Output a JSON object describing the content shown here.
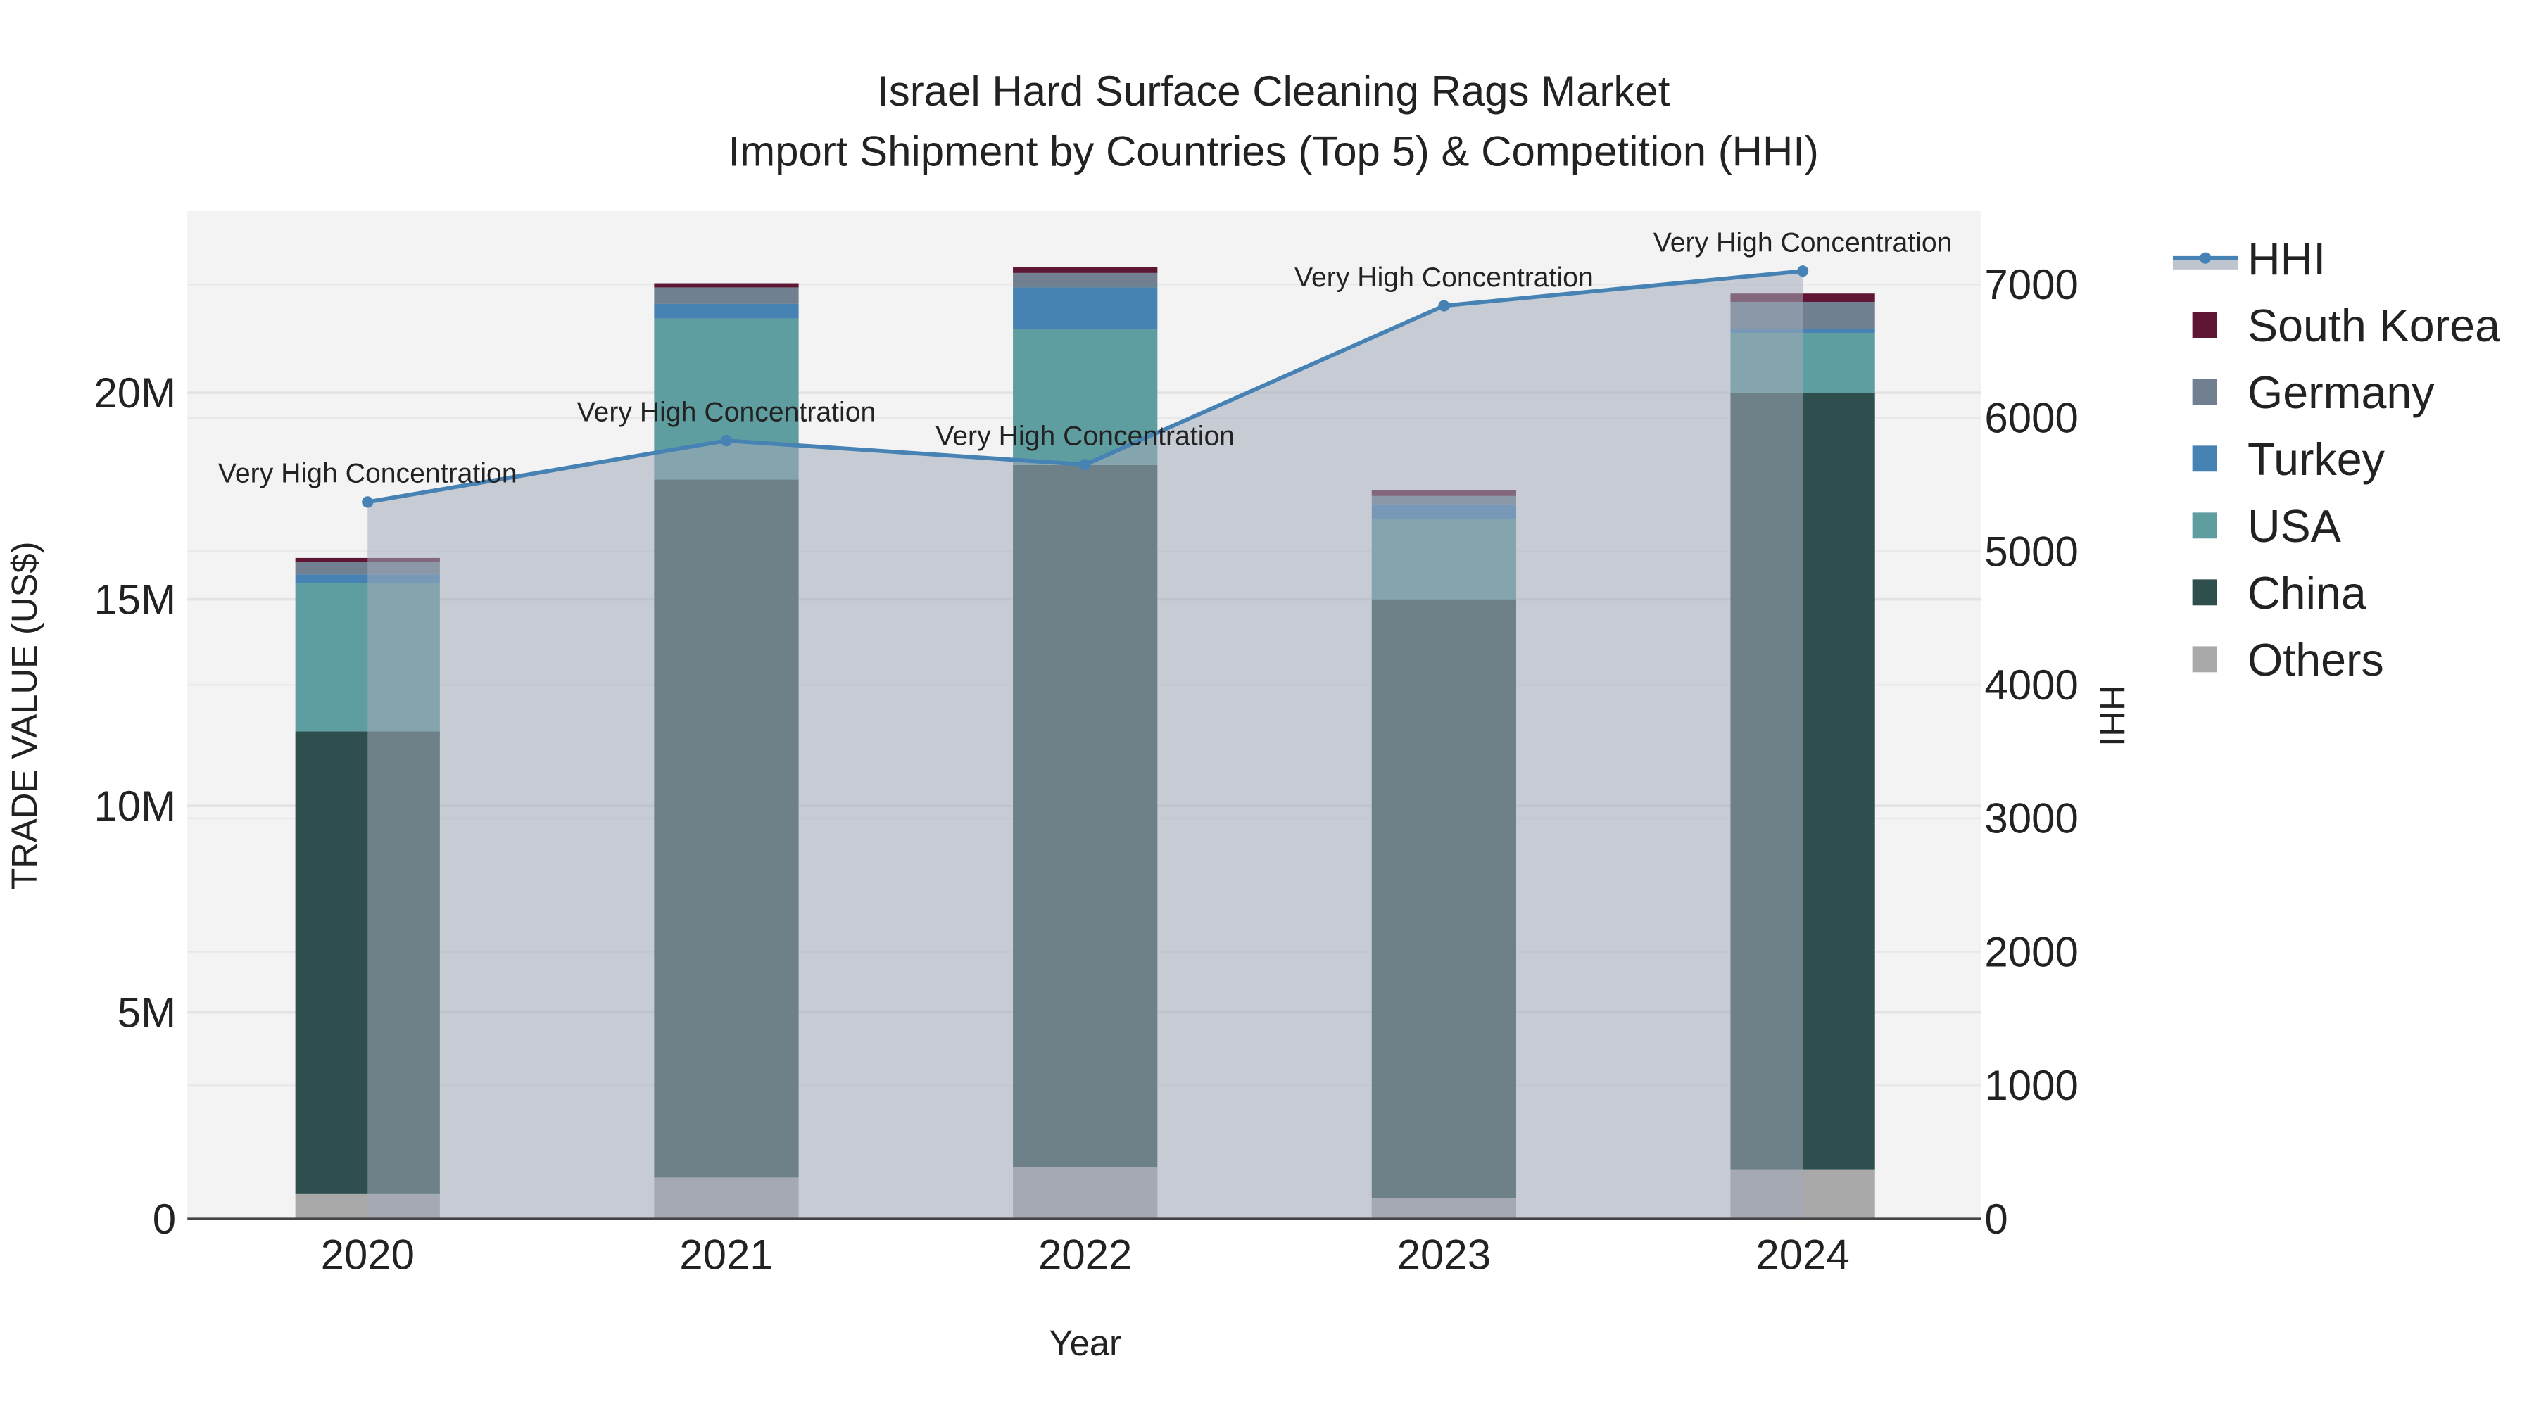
{
  "chart_data": {
    "type": "bar",
    "title": "Israel Hard Surface Cleaning Rags Market",
    "subtitle": "Import Shipment by Countries (Top 5) & Competition (HHI)",
    "xlabel": "Year",
    "ylabel": "TRADE VALUE (US$)",
    "y2label": "HHI",
    "categories": [
      "2020",
      "2021",
      "2022",
      "2023",
      "2024"
    ],
    "ylim": [
      0,
      24400000
    ],
    "y2lim": [
      0,
      7550
    ],
    "yticks": [
      {
        "v": 0,
        "label": "0"
      },
      {
        "v": 5000000,
        "label": "5M"
      },
      {
        "v": 10000000,
        "label": "10M"
      },
      {
        "v": 15000000,
        "label": "15M"
      },
      {
        "v": 20000000,
        "label": "20M"
      }
    ],
    "y2ticks": [
      0,
      1000,
      2000,
      3000,
      4000,
      5000,
      6000,
      7000
    ],
    "grid": true,
    "legend_placement": "right",
    "series": [
      {
        "name": "Others",
        "color": "#a9a9a9",
        "values": [
          600000,
          1000000,
          1250000,
          500000,
          1200000
        ]
      },
      {
        "name": "China",
        "color": "#2f4f4f",
        "values": [
          11200000,
          16900000,
          17000000,
          14500000,
          18800000
        ]
      },
      {
        "name": "USA",
        "color": "#5f9ea0",
        "values": [
          3600000,
          3900000,
          3300000,
          1950000,
          1450000
        ]
      },
      {
        "name": "Turkey",
        "color": "#4682b4",
        "values": [
          200000,
          350000,
          1000000,
          350000,
          100000
        ]
      },
      {
        "name": "Germany",
        "color": "#708090",
        "values": [
          300000,
          400000,
          350000,
          200000,
          650000
        ]
      },
      {
        "name": "South Korea",
        "color": "#5e1634",
        "values": [
          100000,
          100000,
          150000,
          150000,
          200000
        ]
      }
    ],
    "hhi": {
      "name": "HHI",
      "color": "#4682b4",
      "values": [
        5370,
        5830,
        5650,
        6840,
        7100
      ],
      "annotations": [
        "Very High Concentration",
        "Very High Concentration",
        "Very High Concentration",
        "Very High Concentration",
        "Very High Concentration"
      ]
    },
    "legend": [
      "HHI",
      "South Korea",
      "Germany",
      "Turkey",
      "USA",
      "China",
      "Others"
    ]
  }
}
